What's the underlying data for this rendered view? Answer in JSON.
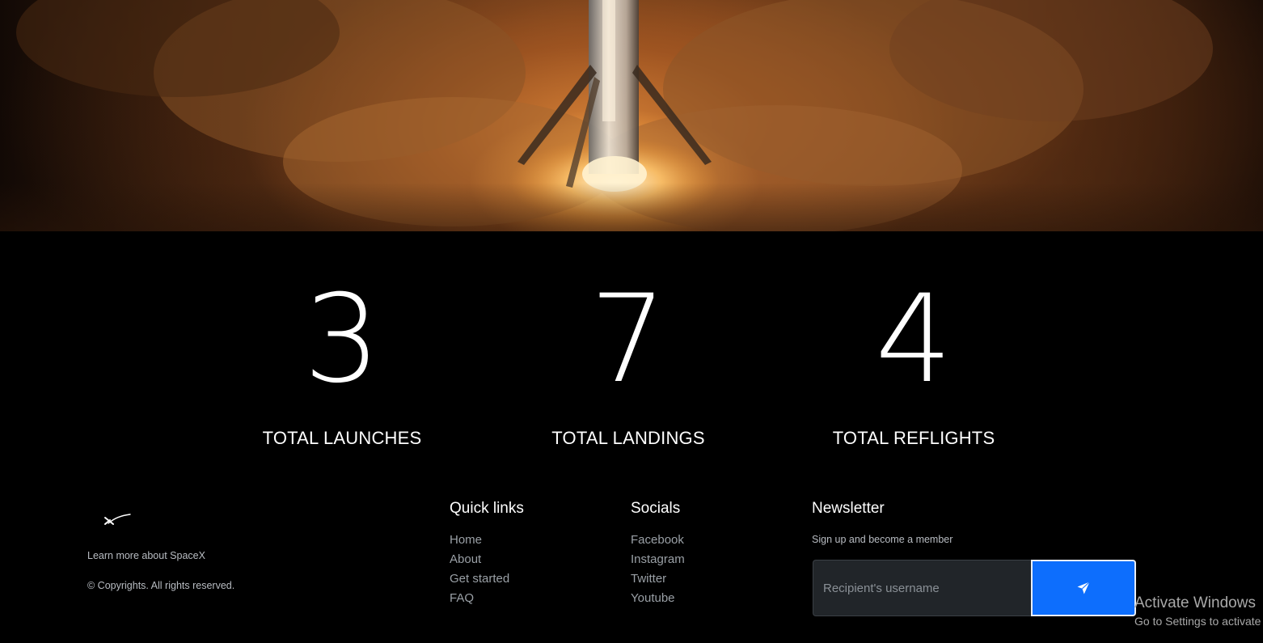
{
  "stats": [
    {
      "number": "3",
      "label": "TOTAL LAUNCHES"
    },
    {
      "number": "7",
      "label": "TOTAL LANDINGS"
    },
    {
      "number": "4",
      "label": "TOTAL REFLIGHTS"
    }
  ],
  "footer": {
    "tagline": "Learn more about SpaceX",
    "copyright": "© Copyrights. All rights reserved.",
    "quick_links": {
      "title": "Quick links",
      "items": [
        "Home",
        "About",
        "Get started",
        "FAQ"
      ]
    },
    "socials": {
      "title": "Socials",
      "items": [
        "Facebook",
        "Instagram",
        "Twitter",
        "Youtube"
      ]
    },
    "newsletter": {
      "title": "Newsletter",
      "subtitle": "Sign up and become a member",
      "input_placeholder": "Recipient's username",
      "button_icon": "send-icon",
      "button_color": "#0d6efd"
    }
  },
  "os_watermark": {
    "title": "Activate Windows",
    "subtitle": "Go to Settings to activate Windows."
  }
}
